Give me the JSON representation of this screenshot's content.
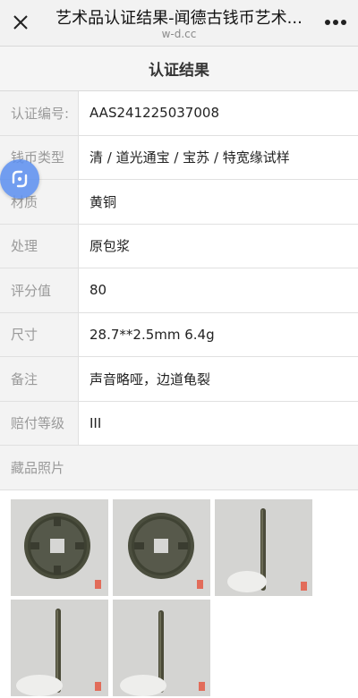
{
  "titlebar": {
    "title": "艺术品认证结果-闻德古钱币艺术...",
    "url": "w-d.cc"
  },
  "section_title": "认证结果",
  "rows": [
    {
      "label": "认证编号:",
      "value": "AAS241225037008"
    },
    {
      "label": "钱币类型",
      "value": "清 / 道光通宝 / 宝苏 / 特宽缘试样"
    },
    {
      "label": "材质",
      "value": "黄铜"
    },
    {
      "label": "处理",
      "value": "原包浆"
    },
    {
      "label": "评分值",
      "value": "80"
    },
    {
      "label": "尺寸",
      "value": "28.7**2.5mm 6.4g"
    },
    {
      "label": "备注",
      "value": "声音略哑，边道龟裂"
    },
    {
      "label": "赔付等级",
      "value": "III"
    }
  ],
  "photos_label": "藏品照片",
  "icons": {
    "close": "close-icon",
    "more": "more-icon",
    "float": "float-action-icon"
  },
  "colors": {
    "badge": "#5b8ff0",
    "coin": "#4a4d3c",
    "photo_bg": "#d9d9d9"
  }
}
